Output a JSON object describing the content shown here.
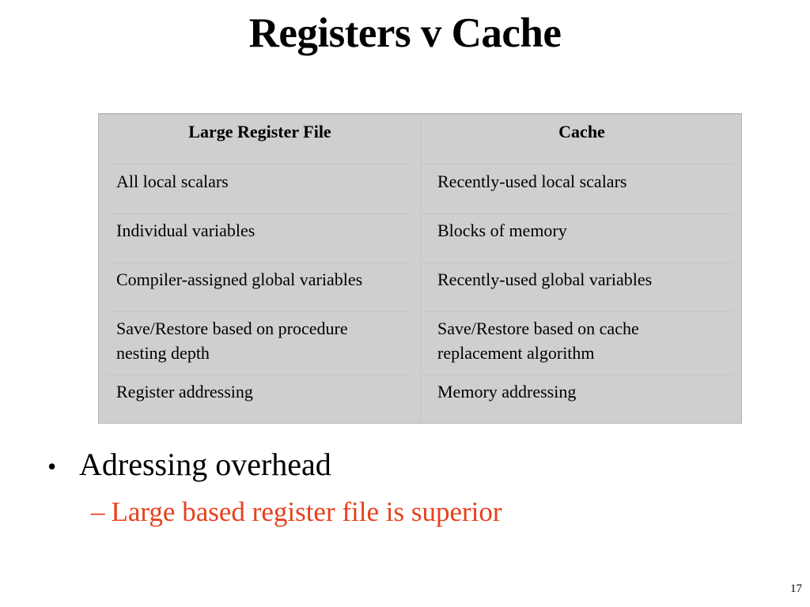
{
  "slide": {
    "title": "Registers v Cache",
    "page_number": "17"
  },
  "table": {
    "headers": [
      "Large Register File",
      "Cache"
    ],
    "rows": [
      [
        "All local scalars",
        "Recently-used local scalars"
      ],
      [
        "Individual variables",
        "Blocks of memory"
      ],
      [
        "Compiler-assigned global variables",
        "Recently-used global variables"
      ],
      [
        "Save/Restore based on procedure nesting depth",
        "Save/Restore based on cache replacement algorithm"
      ],
      [
        "Register addressing",
        "Memory addressing"
      ]
    ]
  },
  "bullets": [
    {
      "text": "Adressing overhead",
      "bullet_glyph": "•",
      "sub": [
        {
          "text": "Large based register file is superior",
          "dash_glyph": "–",
          "color": "#e8401c"
        }
      ]
    }
  ]
}
